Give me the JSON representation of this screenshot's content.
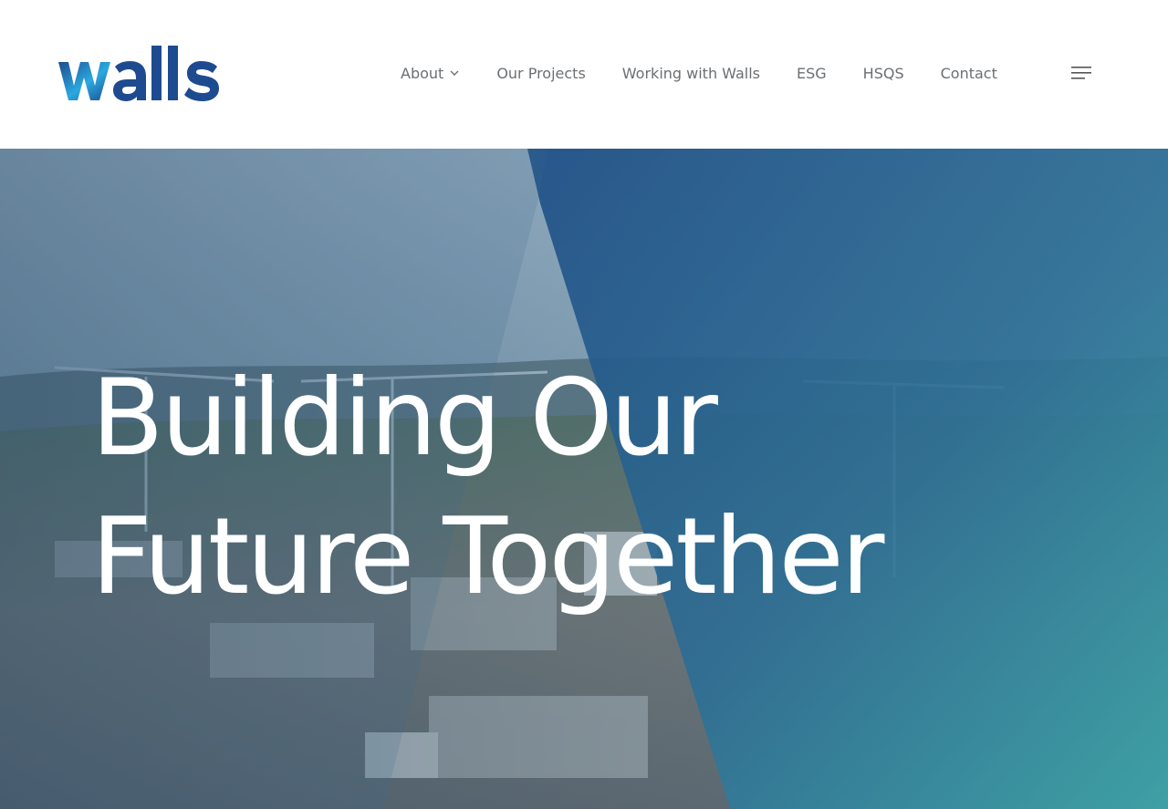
{
  "brand": {
    "name": "walls",
    "colors": {
      "dark_blue": "#1e4b8f",
      "light_blue": "#2aa9e0",
      "teal": "#3ba4a8"
    }
  },
  "nav": {
    "items": [
      {
        "label": "About",
        "has_dropdown": true
      },
      {
        "label": "Our Projects"
      },
      {
        "label": "Working with Walls"
      },
      {
        "label": "ESG"
      },
      {
        "label": "HSQS"
      },
      {
        "label": "Contact"
      }
    ],
    "menu_icon": "hamburger-icon"
  },
  "hero": {
    "headline_line1": "Building Our",
    "headline_line2": "Future Together"
  }
}
